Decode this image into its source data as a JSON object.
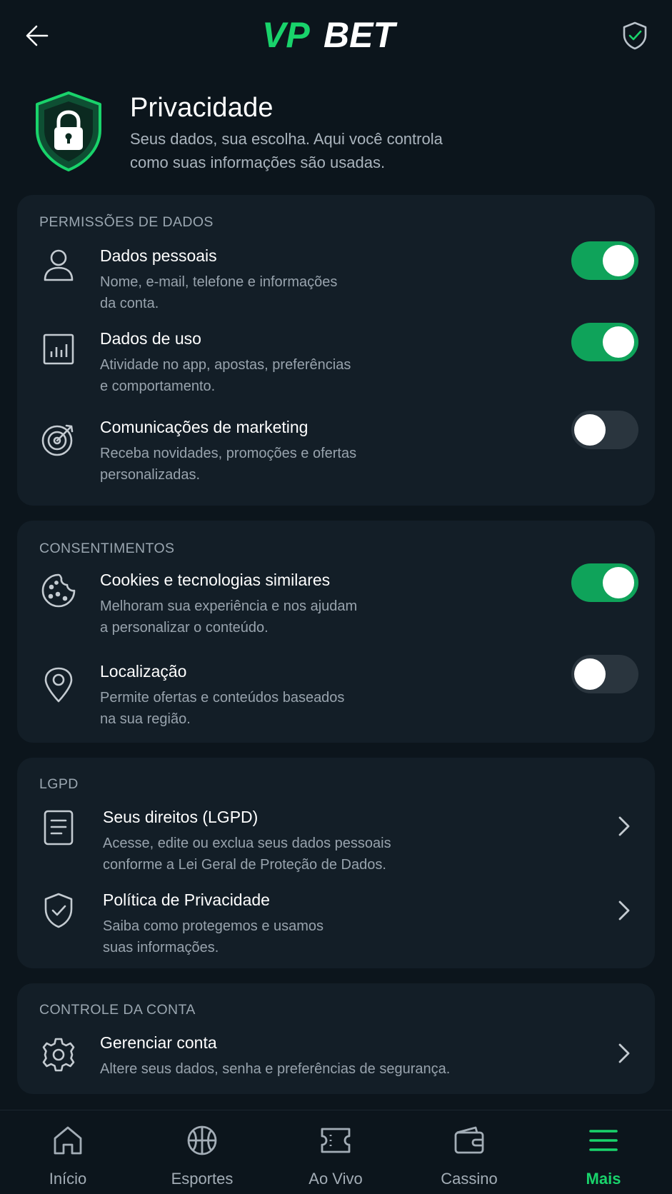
{
  "header": {
    "logo_vp": "VP",
    "logo_bet": "BET",
    "back_icon": "arrow-left-icon",
    "security_icon": "shield-check-icon"
  },
  "hero": {
    "title": "Privacidade",
    "subtitle_line1": "Seus dados, sua escolha. Aqui você controla",
    "subtitle_line2": "como suas informações são usadas."
  },
  "sections": {
    "permissions": {
      "label": "PERMISSÕES DE DADOS",
      "items": [
        {
          "title": "Dados pessoais",
          "desc1": "Nome, e-mail, telefone e informações",
          "desc2": "da conta.",
          "enabled": true,
          "icon": "user-icon"
        },
        {
          "title": "Dados de uso",
          "desc1": "Atividade no app, apostas, preferências",
          "desc2": "e comportamento.",
          "enabled": true,
          "icon": "bar-chart-icon"
        },
        {
          "title": "Comunicações de marketing",
          "desc1": "Receba novidades, promoções e ofertas",
          "desc2": "personalizadas.",
          "enabled": false,
          "icon": "target-icon"
        }
      ]
    },
    "consents": {
      "label": "CONSENTIMENTOS",
      "items": [
        {
          "title": "Cookies e tecnologias similares",
          "desc1": "Melhoram sua experiência e nos ajudam",
          "desc2": "a personalizar o conteúdo.",
          "enabled": true,
          "icon": "cookie-icon"
        },
        {
          "title": "Localização",
          "desc1": "Permite ofertas e conteúdos baseados",
          "desc2": "na sua região.",
          "enabled": false,
          "icon": "location-pin-icon"
        }
      ]
    },
    "lgpd": {
      "label": "LGPD",
      "items": [
        {
          "title": "Seus direitos (LGPD)",
          "desc1": "Acesse, edite ou exclua seus dados pessoais",
          "desc2": "conforme a Lei Geral de Proteção de Dados.",
          "icon": "document-icon"
        },
        {
          "title": "Política de Privacidade",
          "desc1": "Saiba como protegemos e usamos",
          "desc2": "suas informações.",
          "icon": "shield-check-icon"
        }
      ]
    },
    "account": {
      "label": "CONTROLE DA CONTA",
      "items": [
        {
          "title": "Gerenciar conta",
          "desc1": "Altere seus dados, senha e preferências de segurança.",
          "icon": "gear-icon"
        }
      ]
    }
  },
  "nav": {
    "items": [
      {
        "label": "Início",
        "icon": "home-icon",
        "active": false
      },
      {
        "label": "Esportes",
        "icon": "basketball-icon",
        "active": false
      },
      {
        "label": "Ao Vivo",
        "icon": "ticket-icon",
        "active": false
      },
      {
        "label": "Cassino",
        "icon": "wallet-icon",
        "active": false
      },
      {
        "label": "Mais",
        "icon": "menu-icon",
        "active": true
      }
    ]
  },
  "colors": {
    "accent": "#19d36b",
    "toggle_on": "#0fa35a",
    "card_bg": "#131e27",
    "page_bg": "#0c151c"
  }
}
